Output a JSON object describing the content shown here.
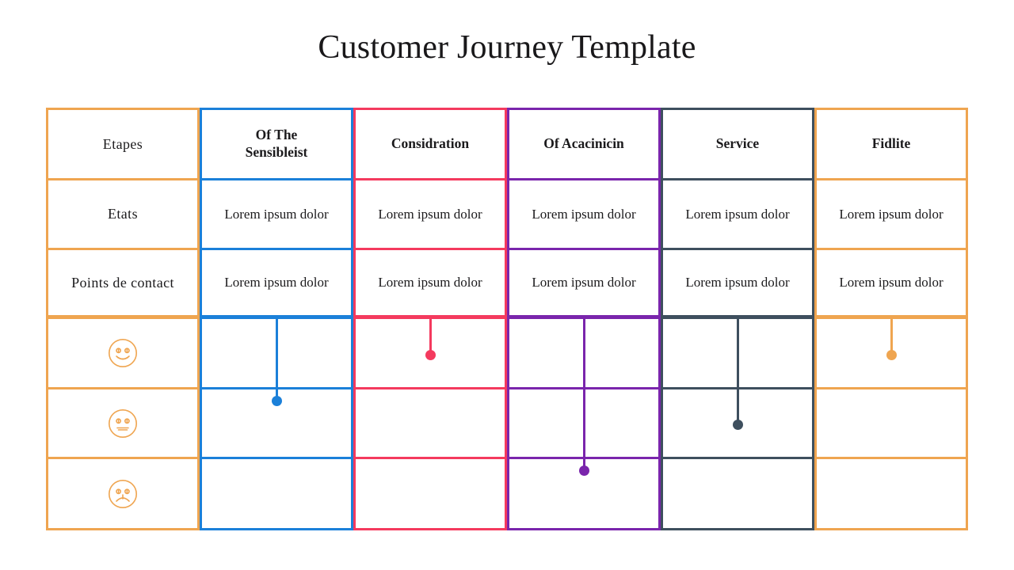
{
  "slide": {
    "title": "Customer Journey Template",
    "background": "#ffffff"
  },
  "colors": {
    "orange": "#efa550",
    "blue": "#1b80d9",
    "pink": "#f43a5e",
    "purple": "#7a25ac",
    "slate": "#3e4f5e",
    "text": "#1b1a1c"
  },
  "grid": {
    "columns": [
      {
        "key": "labels",
        "accent_name": "orange",
        "accent": "#efa550",
        "header": "Etapes",
        "header_bold": false,
        "etats": "",
        "points": "",
        "connector": null
      },
      {
        "key": "sensibleist",
        "accent_name": "blue",
        "accent": "#1b80d9",
        "header": "Of The Sensibleist",
        "header_bold": true,
        "etats": "Lorem ipsum dolor",
        "points": "Lorem ipsum dolor",
        "connector": {
          "dot_row": 2,
          "dot_position": "top"
        }
      },
      {
        "key": "considration",
        "accent_name": "pink",
        "accent": "#f43a5e",
        "header": "Considration",
        "header_bold": true,
        "etats": "Lorem ipsum dolor",
        "points": "Lorem ipsum dolor",
        "connector": {
          "dot_row": 1,
          "dot_position": "middle"
        }
      },
      {
        "key": "acacinicin",
        "accent_name": "purple",
        "accent": "#7a25ac",
        "header": "Of Acacinicin",
        "header_bold": true,
        "etats": "Lorem ipsum dolor",
        "points": "Lorem ipsum dolor",
        "connector": {
          "dot_row": 3,
          "dot_position": "top"
        }
      },
      {
        "key": "service",
        "accent_name": "slate",
        "accent": "#3e4f5e",
        "header": "Service",
        "header_bold": true,
        "etats": "Lorem ipsum dolor",
        "points": "Lorem ipsum dolor",
        "connector": {
          "dot_row": 2,
          "dot_position": "middle"
        }
      },
      {
        "key": "fidlite",
        "accent_name": "orange",
        "accent": "#efa550",
        "header": "Fidlite",
        "header_bold": true,
        "etats": "Lorem ipsum dolor",
        "points": "Lorem ipsum dolor",
        "connector": {
          "dot_row": 1,
          "dot_position": "middle"
        }
      }
    ],
    "row_labels": {
      "header": "Etapes",
      "etats": "Etats",
      "points": "Points de contact"
    },
    "mood_rows": [
      {
        "key": "happy",
        "icon": "smiley-happy-icon",
        "color": "#efa550"
      },
      {
        "key": "neutral",
        "icon": "smiley-neutral-icon",
        "color": "#efa550"
      },
      {
        "key": "sad",
        "icon": "smiley-sad-icon",
        "color": "#efa550"
      }
    ]
  }
}
